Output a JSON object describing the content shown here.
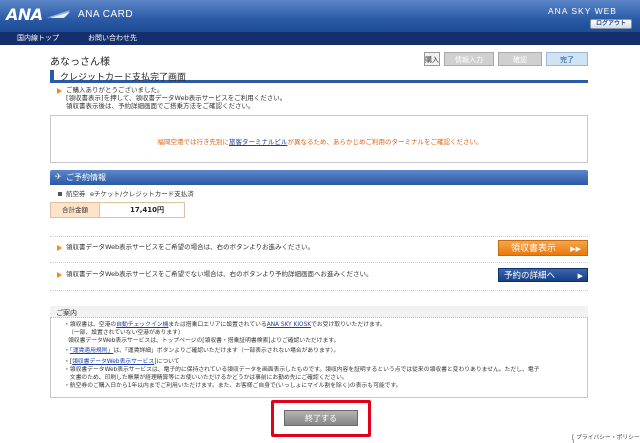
{
  "header": {
    "logo": "ANA",
    "brand": "ANA CARD",
    "site": "ANA SKY WEB",
    "logout_label": "ログアウト"
  },
  "nav": {
    "items": [
      "国内線トップ",
      "お問い合わせ先"
    ]
  },
  "user": {
    "greeting": "あなっさん様"
  },
  "steps": {
    "start": "購入",
    "items": [
      "情報入力",
      "確認",
      "完了"
    ],
    "current": "完了"
  },
  "page": {
    "title": "クレジットカード支払完了画面"
  },
  "messages": {
    "line1": "ご購入ありがとうございました。",
    "line2": "[領収書表示]を押して、領収書データWeb表示サービスをご利用ください。",
    "line3": "領収書表示後は、予約詳細画面でご搭乗方法をご確認ください。"
  },
  "notice": {
    "before": "福岡空港では行き先別に",
    "link": "旅客ターミナルビル",
    "after": "が異なるため、あらかじめご利用のターミナルをご確認ください。"
  },
  "reservation": {
    "section_title": "ご予約情報",
    "item_label": "航空券",
    "item_value": "eチケット/クレジットカード支払済",
    "total_label": "合計金額",
    "total_value": "17,410円"
  },
  "actions": {
    "receipt_text": "領収書データWeb表示サービスをご希望の場合は、右のボタンよりお進みください。",
    "receipt_button": "領収書表示",
    "detail_text": "領収書データWeb表示サービスをご希望でない場合は、右のボタンより予約詳細画面へお進みください。",
    "detail_button": "予約の詳細へ"
  },
  "guide": {
    "title": "ご案内",
    "line1_a": "・領収書は、空港の",
    "line1_link": "自動チェックイン機",
    "line1_b": "または搭乗口エリアに設置されている",
    "line1_link2": "ANA SKY KIOSK",
    "line1_c": "でお受け取りいただけます。",
    "line2": "（一部、設置されていない空港があります）",
    "line3": "領収書データWeb表示サービスは、トップページの[領収書・搭乗証明書検索]よりご確認いただけます。",
    "line4_a": "・",
    "line4_link": "「運賃適用規則」",
    "line4_b": "は、「運賃詳細」ボタンよりご確認いただけます（一部表示されない場合があります）。",
    "line5_a": "・[",
    "line5_link": "領収書データWeb表示サービス",
    "line5_b": "]について",
    "line6": "・領収書データWeb表示サービスは、電子的に保持されている領収データを画面表示したものです。領収内容を証明するという点では従来の領収書と変わりありません。ただし、電子",
    "line7": "　文書のため、印刷した帳票が経理精算等にお使いいただけるかどうかは事前にお勤め先にご確認ください。",
    "line8": "・航空券のご購入日から1年以内までご利用いただけます。また、お客様ご自身で(いっしょにマイル割を除く)の表示も可能です。"
  },
  "footer": {
    "finish_button": "終了する",
    "privacy": "[ プライバシー・ポリシー ]"
  },
  "colors": {
    "brand_blue": "#2b5aa6",
    "nav_navy": "#142f6c",
    "accent_orange": "#e8780c",
    "highlight_red": "#e0001a"
  }
}
